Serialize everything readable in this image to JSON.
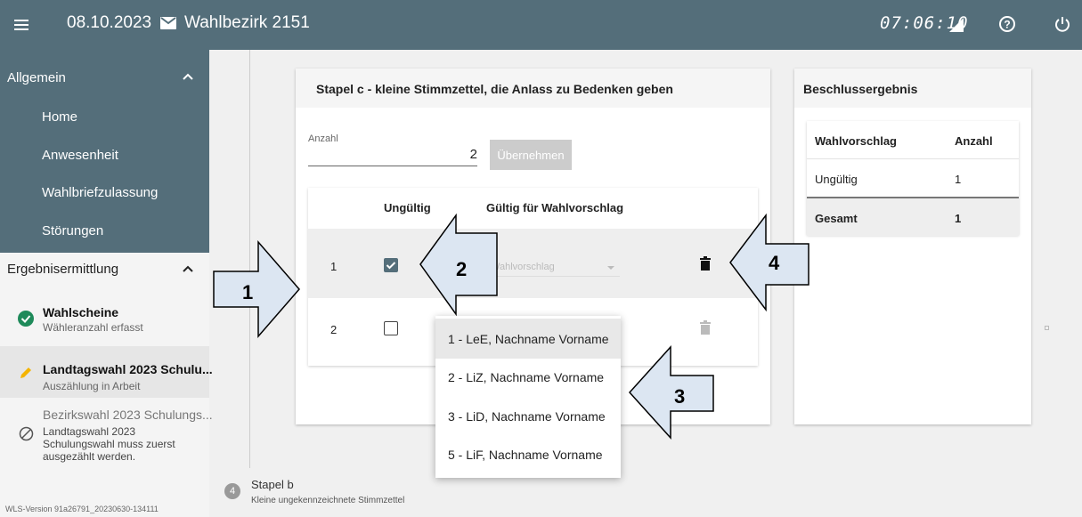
{
  "topbar": {
    "date": "08.10.2023",
    "district": "Wahlbezirk 2151",
    "clock": "07:06:10",
    "icons": [
      "menu-icon",
      "mail-icon",
      "signal-icon",
      "help-icon",
      "power-icon"
    ]
  },
  "sidebar": {
    "section1": "Allgemein",
    "items": [
      "Home",
      "Anwesenheit",
      "Wahlbriefzulassung",
      "Störungen"
    ],
    "section2": "Ergebnisermittlung",
    "steps": [
      {
        "title": "Wahlscheine",
        "sub": "Wähleranzahl erfasst",
        "icon": "check-circle-icon"
      },
      {
        "title": "Landtagswahl 2023 Schulu...",
        "sub": "Auszählung in Arbeit",
        "icon": "pencil-icon"
      },
      {
        "title": "Bezirkswahl 2023 Schulungs...",
        "sub": "Landtagswahl 2023 Schulungswahl muss zuerst ausgezählt werden.",
        "icon": "blocked-icon"
      }
    ],
    "version": "WLS-Version 91a26791_20230630-134111"
  },
  "stapel_c": {
    "title": "Stapel c - kleine Stimmzettel, die Anlass zu Bedenken geben",
    "anzahl_label": "Anzahl",
    "anzahl_value": "2",
    "button": "Übernehmen",
    "col_invalid": "Ungültig",
    "col_valid": "Gültig für Wahlvorschlag",
    "rows": [
      {
        "num": "1",
        "checked": true,
        "placeholder": "Wahlvorschlag"
      },
      {
        "num": "2",
        "checked": false,
        "placeholder": ""
      }
    ]
  },
  "dropdown": {
    "options": [
      "1 - LeE, Nachname Vorname",
      "2 - LiZ, Nachname Vorname",
      "3 - LiD, Nachname Vorname",
      "5 - LiF, Nachname Vorname"
    ]
  },
  "result": {
    "title": "Beschlussergebnis",
    "col1": "Wahlvorschlag",
    "col2": "Anzahl",
    "rows": [
      {
        "label": "Ungültig",
        "value": "1"
      },
      {
        "label": "Gesamt",
        "value": "1"
      }
    ]
  },
  "stapel_b": {
    "num": "4",
    "title": "Stapel b",
    "sub": "Kleine ungekennzeichnete Stimmzettel"
  },
  "callouts": [
    "1",
    "2",
    "3",
    "4"
  ],
  "colors": {
    "header": "#546e7a",
    "sidebar_dark": "#546e7a",
    "callout_fill": "#dce6f2"
  }
}
